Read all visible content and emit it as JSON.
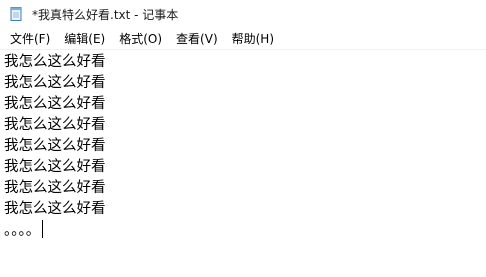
{
  "window": {
    "title": "*我真特么好看.txt - 记事本",
    "icon": "notepad-icon"
  },
  "menu": {
    "items": [
      {
        "label": "文件(F)"
      },
      {
        "label": "编辑(E)"
      },
      {
        "label": "格式(O)"
      },
      {
        "label": "查看(V)"
      },
      {
        "label": "帮助(H)"
      }
    ]
  },
  "editor": {
    "lines": [
      "我怎么这么好看",
      "我怎么这么好看",
      "我怎么这么好看",
      "我怎么这么好看",
      "我怎么这么好看",
      "我怎么这么好看",
      "我怎么这么好看",
      "我怎么这么好看",
      "。。。。"
    ]
  }
}
